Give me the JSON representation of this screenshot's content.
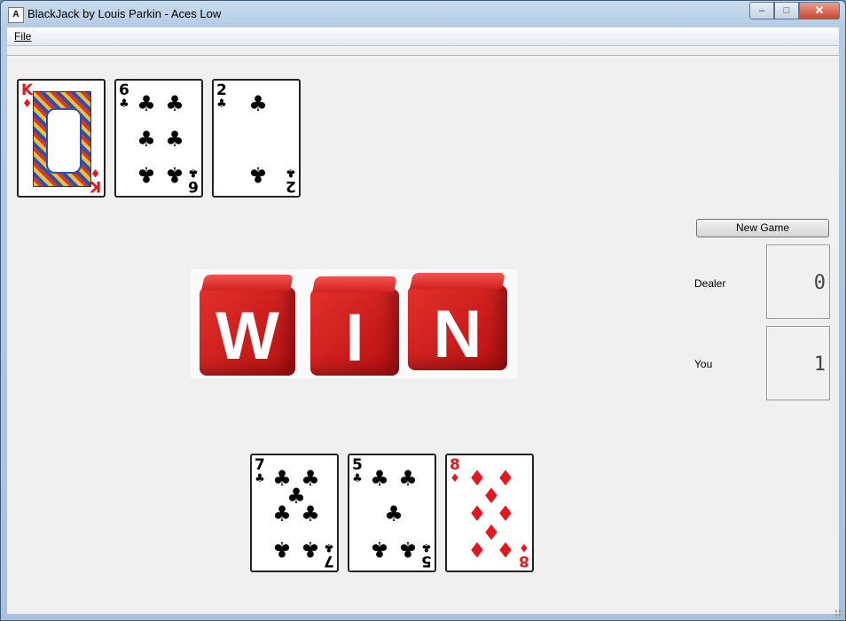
{
  "window": {
    "title": "BlackJack by Louis Parkin - Aces Low",
    "icon": "blackjack-app-icon",
    "controls": {
      "minimize": "–",
      "maximize": "□",
      "close": "✕"
    }
  },
  "menu": {
    "file": "File"
  },
  "dealer_hand": [
    {
      "rank": "K",
      "suit": "♦",
      "color": "#e3181d",
      "face": true
    },
    {
      "rank": "6",
      "suit": "♣",
      "color": "#000000",
      "face": false
    },
    {
      "rank": "2",
      "suit": "♣",
      "color": "#000000",
      "face": false
    }
  ],
  "player_hand": [
    {
      "rank": "7",
      "suit": "♣",
      "color": "#000000",
      "face": false
    },
    {
      "rank": "5",
      "suit": "♣",
      "color": "#000000",
      "face": false
    },
    {
      "rank": "8",
      "suit": "♦",
      "color": "#e3181d",
      "face": false
    }
  ],
  "result_banner": {
    "letters": [
      "W",
      "I",
      "N"
    ],
    "color": "#d2211f"
  },
  "controls": {
    "new_game": "New Game",
    "dealer_label": "Dealer",
    "you_label": "You",
    "dealer_score": "0",
    "player_score": "1"
  }
}
